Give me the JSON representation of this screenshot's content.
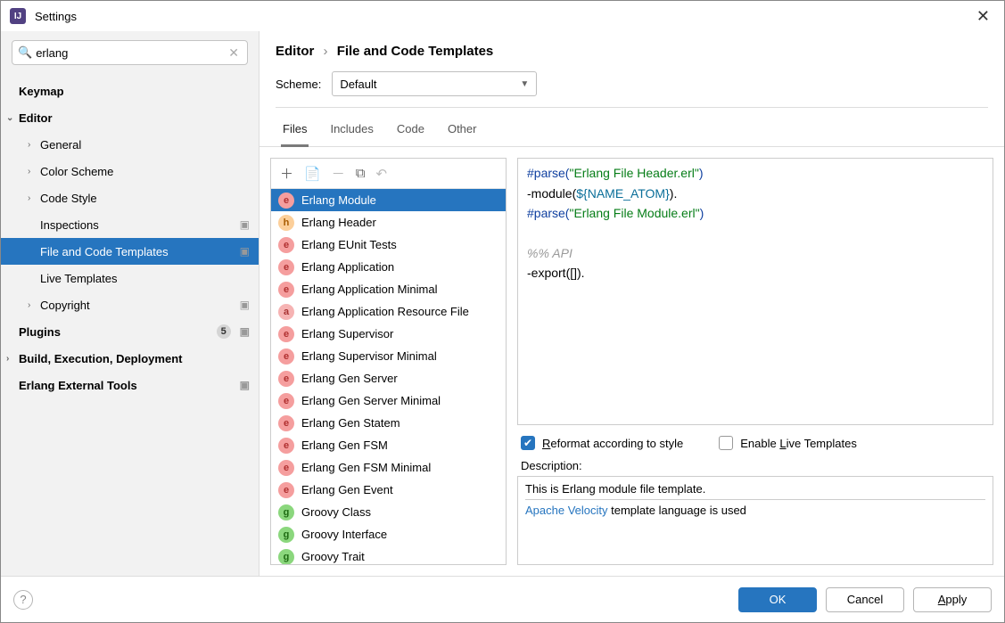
{
  "window": {
    "title": "Settings"
  },
  "search": {
    "value": "erlang"
  },
  "sidebar": {
    "items": [
      {
        "label": "Keymap",
        "level": 0,
        "bold": true
      },
      {
        "label": "Editor",
        "level": 0,
        "bold": true,
        "expanded": true
      },
      {
        "label": "General",
        "level": 1,
        "chevron": true
      },
      {
        "label": "Color Scheme",
        "level": 1,
        "chevron": true
      },
      {
        "label": "Code Style",
        "level": 1,
        "chevron": true
      },
      {
        "label": "Inspections",
        "level": 1,
        "ext": true
      },
      {
        "label": "File and Code Templates",
        "level": 1,
        "selected": true,
        "ext": true
      },
      {
        "label": "Live Templates",
        "level": 1
      },
      {
        "label": "Copyright",
        "level": 1,
        "chevron": true,
        "ext": true
      },
      {
        "label": "Plugins",
        "level": 0,
        "bold": true,
        "badge": "5",
        "ext": true
      },
      {
        "label": "Build, Execution, Deployment",
        "level": 0,
        "bold": true,
        "chevron": true
      },
      {
        "label": "Erlang External Tools",
        "level": 0,
        "bold": true,
        "ext": true
      }
    ]
  },
  "breadcrumb": {
    "a": "Editor",
    "b": "File and Code Templates"
  },
  "scheme": {
    "label": "Scheme:",
    "value": "Default"
  },
  "tabs": [
    "Files",
    "Includes",
    "Code",
    "Other"
  ],
  "active_tab": 0,
  "templates": [
    {
      "name": "Erlang Module",
      "type": "e",
      "selected": true
    },
    {
      "name": "Erlang Header",
      "type": "h"
    },
    {
      "name": "Erlang EUnit Tests",
      "type": "e"
    },
    {
      "name": "Erlang Application",
      "type": "e"
    },
    {
      "name": "Erlang Application Minimal",
      "type": "e"
    },
    {
      "name": "Erlang Application Resource File",
      "type": "a"
    },
    {
      "name": "Erlang Supervisor",
      "type": "e"
    },
    {
      "name": "Erlang Supervisor Minimal",
      "type": "e"
    },
    {
      "name": "Erlang Gen Server",
      "type": "e"
    },
    {
      "name": "Erlang Gen Server Minimal",
      "type": "e"
    },
    {
      "name": "Erlang Gen Statem",
      "type": "e"
    },
    {
      "name": "Erlang Gen FSM",
      "type": "e"
    },
    {
      "name": "Erlang Gen FSM Minimal",
      "type": "e"
    },
    {
      "name": "Erlang Gen Event",
      "type": "e"
    },
    {
      "name": "Groovy Class",
      "type": "g"
    },
    {
      "name": "Groovy Interface",
      "type": "g"
    },
    {
      "name": "Groovy Trait",
      "type": "g"
    }
  ],
  "editor": {
    "l1_a": "#parse(",
    "l1_b": "\"Erlang File Header.erl\"",
    "l1_c": ")",
    "l2_a": "-module(",
    "l2_b": "${NAME_ATOM}",
    "l2_c": ").",
    "l3_a": "#parse(",
    "l3_b": "\"Erlang File Module.erl\"",
    "l3_c": ")",
    "l5": "%% API",
    "l6": "-export([])."
  },
  "checks": {
    "reformat_prefix": "R",
    "reformat_rest": "eformat according to style",
    "live_prefix": "Enable ",
    "live_u": "L",
    "live_rest": "ive Templates"
  },
  "description": {
    "label": "Description:",
    "text": "This is Erlang module file template.",
    "link": "Apache Velocity",
    "suffix": " template language is used"
  },
  "footer": {
    "ok": "OK",
    "cancel": "Cancel",
    "apply_u": "A",
    "apply_rest": "pply"
  }
}
